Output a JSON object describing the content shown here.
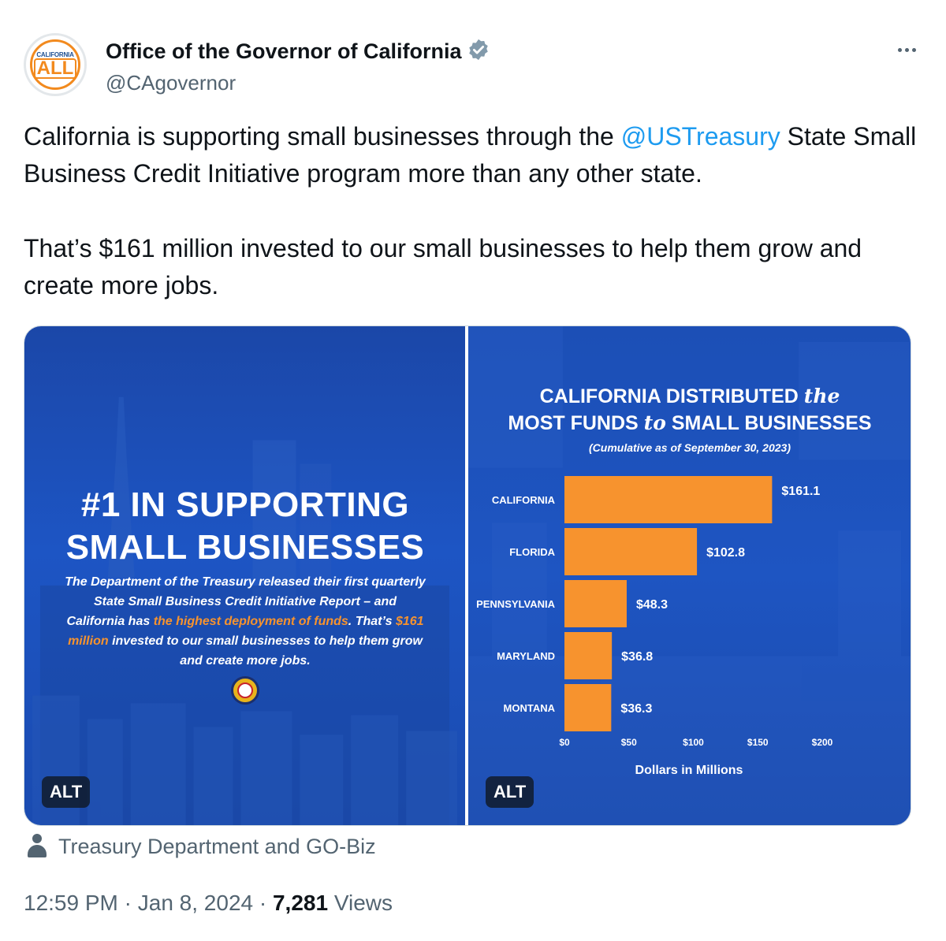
{
  "author": {
    "name": "Office of the Governor of California",
    "handle": "@CAgovernor",
    "avatar_top": "CALIFORNIA",
    "avatar_main": "ALL",
    "verified_icon": "verified-badge-icon",
    "brand_color": "#f28a1e"
  },
  "tweet": {
    "line1_prefix": "California is supporting small businesses through the ",
    "mention": "@USTreasury",
    "line1_suffix": " State Small Business Credit Initiative program more than any other state.",
    "paragraph2": "That’s $161 million invested to our small businesses to help them grow and create more jobs."
  },
  "media": {
    "left": {
      "title_line1": "#1 IN SUPPORTING",
      "title_line2": "SMALL BUSINESSES",
      "body_1": "The Department of the Treasury released their first quarterly State Small Business Credit Initiative Report – and California has ",
      "body_hl1": "the highest deployment of funds",
      "body_2": ". That’s ",
      "body_hl2": "$161 million",
      "body_3": " invested to our small businesses to help them grow and create more jobs.",
      "alt": "ALT"
    },
    "right": {
      "title_line1a": "CALIFORNIA DISTRIBUTED ",
      "title_line1b": "the",
      "title_line2a": "MOST FUNDS ",
      "title_line2b": "to",
      "title_line2c": " SMALL BUSINESSES",
      "subtitle": "(Cumulative as of September 30, 2023)",
      "alt": "ALT"
    }
  },
  "chart_data": {
    "type": "bar",
    "orientation": "horizontal",
    "title": "CALIFORNIA DISTRIBUTED the MOST FUNDS to SMALL BUSINESSES",
    "subtitle": "(Cumulative as of September 30, 2023)",
    "categories": [
      "CALIFORNIA",
      "FLORIDA",
      "PENNSYLVANIA",
      "MARYLAND",
      "MONTANA"
    ],
    "values": [
      161.1,
      102.8,
      48.3,
      36.8,
      36.3
    ],
    "value_labels": [
      "$161.1",
      "$102.8",
      "$48.3",
      "$36.8",
      "$36.3"
    ],
    "xlabel": "Dollars in Millions",
    "x_ticks": [
      0,
      50,
      100,
      150,
      200
    ],
    "x_tick_labels": [
      "$0",
      "$50",
      "$100",
      "$150",
      "$200"
    ],
    "xlim": [
      0,
      200
    ],
    "bar_color": "#f7932e",
    "grid": false
  },
  "attribution": {
    "icon": "person-icon",
    "text": "Treasury Department and GO-Biz"
  },
  "meta": {
    "time": "12:59 PM",
    "sep1": " · ",
    "date": "Jan 8, 2024",
    "sep2": " · ",
    "views_count": "7,281",
    "views_label": " Views"
  }
}
